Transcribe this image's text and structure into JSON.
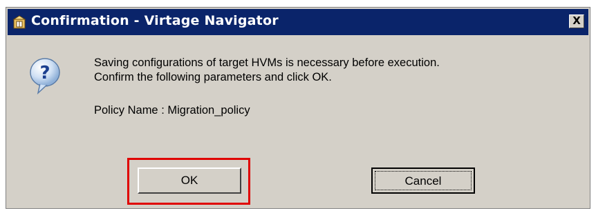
{
  "window": {
    "title": "Confirmation - Virtage Navigator",
    "close_label": "X"
  },
  "icons": {
    "app": "app-icon",
    "message": "question-icon",
    "close": "close-icon"
  },
  "message": {
    "line1": "Saving configurations of target HVMs is necessary before execution.",
    "line2": "Confirm the following parameters and click OK.",
    "policy": "Policy Name : Migration_policy"
  },
  "buttons": {
    "ok_label": "OK",
    "cancel_label": "Cancel"
  },
  "colors": {
    "titlebar": "#0a246a",
    "dialog_bg": "#d4d0c8",
    "highlight": "#e00000"
  }
}
